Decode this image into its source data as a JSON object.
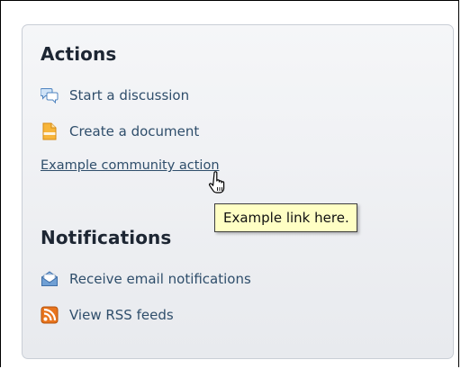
{
  "actions": {
    "title": "Actions",
    "items": [
      {
        "label": "Start a discussion",
        "icon": "discussion-bubbles-icon"
      },
      {
        "label": "Create a document",
        "icon": "document-icon"
      }
    ],
    "community_link": "Example community action"
  },
  "tooltip": {
    "text": "Example link here."
  },
  "notifications": {
    "title": "Notifications",
    "items": [
      {
        "label": "Receive email notifications",
        "icon": "email-envelope-icon"
      },
      {
        "label": "View RSS feeds",
        "icon": "rss-feed-icon"
      }
    ]
  },
  "colors": {
    "link": "#2f4e6b",
    "heading": "#1d2633",
    "tooltip_bg": "#ffffc4",
    "rss": "#e8741d",
    "document": "#f3a72c",
    "envelope": "#5f8fc4"
  }
}
